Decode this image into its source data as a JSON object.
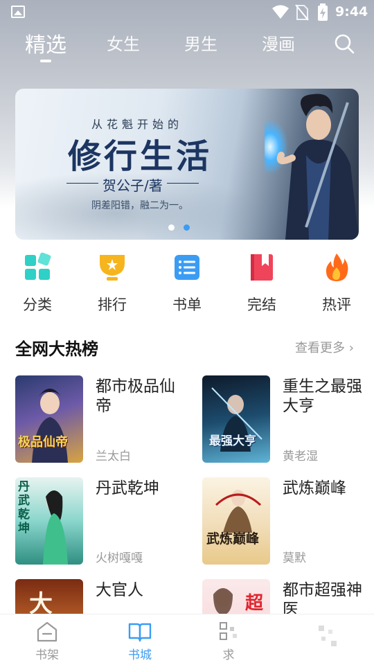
{
  "status_bar": {
    "time": "9:44",
    "icons": [
      "image-icon",
      "wifi-icon",
      "no-sim-icon",
      "battery-charging-icon"
    ]
  },
  "top_tabs": [
    {
      "label": "精选",
      "active": true
    },
    {
      "label": "女生",
      "active": false
    },
    {
      "label": "男生",
      "active": false
    },
    {
      "label": "漫画",
      "active": false
    }
  ],
  "search_icon": "search-icon",
  "banner": {
    "top_line": "从花魁开始的",
    "title": "修行生活",
    "author": "贺公子/著",
    "tagline": "阴差阳错，融二为一。",
    "page_count": 2,
    "active_page": 2
  },
  "categories": [
    {
      "label": "分类",
      "icon": "grid-icon",
      "color": "#2fd0c6"
    },
    {
      "label": "排行",
      "icon": "trophy-icon",
      "color": "#f6b51d"
    },
    {
      "label": "书单",
      "icon": "list-icon",
      "color": "#3b9cf4"
    },
    {
      "label": "完结",
      "icon": "bookmark-book-icon",
      "color": "#f0445a"
    },
    {
      "label": "热评",
      "icon": "flame-icon",
      "color": "#ff6a1a"
    }
  ],
  "hot_list": {
    "title": "全网大热榜",
    "more": "查看更多",
    "books": [
      {
        "name": "都市极品仙帝",
        "author": "兰太白",
        "cover_text": "极品仙帝"
      },
      {
        "name": "重生之最强大亨",
        "author": "黄老湿",
        "cover_text": "最强大亨"
      },
      {
        "name": "丹武乾坤",
        "author": "火树嘎嘎",
        "cover_text": "丹武乾坤"
      },
      {
        "name": "武炼巅峰",
        "author": "莫默",
        "cover_text": "武炼巅峰"
      },
      {
        "name": "大官人",
        "author": "",
        "cover_text": "大"
      },
      {
        "name": "都市超强神医",
        "author": "",
        "cover_text": "超"
      }
    ]
  },
  "tabbar": [
    {
      "label": "书架",
      "icon": "bookshelf-icon",
      "active": false
    },
    {
      "label": "书城",
      "icon": "open-book-icon",
      "active": true
    },
    {
      "label": "求",
      "icon": "request-icon",
      "active": false
    },
    {
      "label": "",
      "icon": "profile-icon",
      "active": false
    }
  ],
  "colors": {
    "accent": "#3b9cf4",
    "muted": "#999999"
  }
}
